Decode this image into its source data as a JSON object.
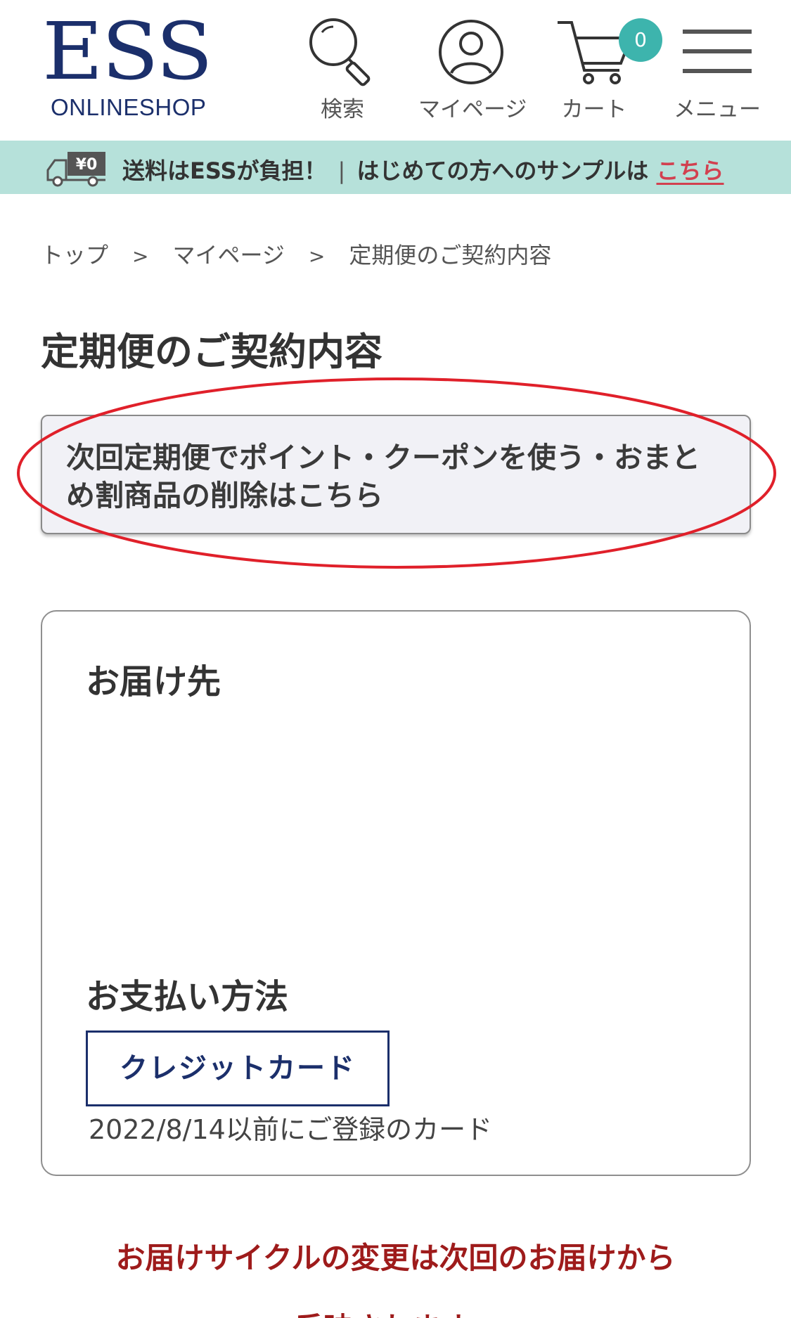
{
  "header": {
    "logo_main": "ESS",
    "logo_sub": "ONLINESHOP",
    "nav": {
      "search_label": "検索",
      "mypage_label": "マイページ",
      "cart_label": "カート",
      "cart_count": "0",
      "menu_label": "メニュー"
    }
  },
  "banner": {
    "truck_price": "¥0",
    "shipping_text": "送料はESSが負担！",
    "separator": "|",
    "sample_text": "はじめての方へのサンプルは",
    "sample_link": "こちら"
  },
  "breadcrumb": {
    "items": [
      "トップ",
      "マイページ",
      "定期便のご契約内容"
    ],
    "separator": ">"
  },
  "page_title": "定期便のご契約内容",
  "notice": {
    "text": "次回定期便でポイント・クーポンを使う・おまとめ割商品の削除はこちら",
    "highlight_color": "#e0202a"
  },
  "contract_card": {
    "delivery_heading": "お届け先",
    "payment_heading": "お支払い方法",
    "payment_method": "クレジットカード",
    "payment_note": "2022/8/14以前にご登録のカード"
  },
  "cycle_notice": {
    "line1": "お届けサイクルの変更は次回のお届けから",
    "line2": "反映されます。"
  },
  "colors": {
    "brand_navy": "#1b2f6b",
    "banner_bg": "#b6e1da",
    "badge_teal": "#3db4ad",
    "link_red": "#d2404f",
    "notice_red": "#9e1b1b"
  }
}
